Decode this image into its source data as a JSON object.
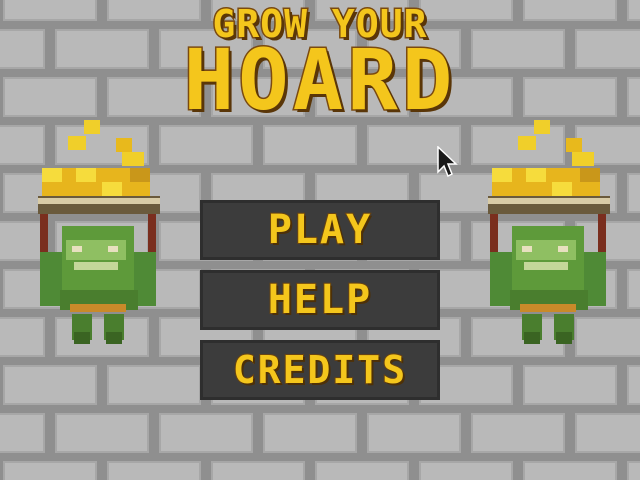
{
  "title": {
    "line1": "GROW YOUR",
    "line2": "HOARD"
  },
  "menu": {
    "play": "PLAY",
    "help": "HELP",
    "credits": "CREDITS"
  },
  "colors": {
    "wall": "#8f8f8f",
    "brick": "#b9b9b9",
    "gold": "#f4c61c",
    "button": "#3c3c3c",
    "goblin": "#5e9a3a"
  },
  "icons": {
    "cursor": "mouse-pointer-icon",
    "goblin": "goblin-carrying-gold-icon"
  }
}
